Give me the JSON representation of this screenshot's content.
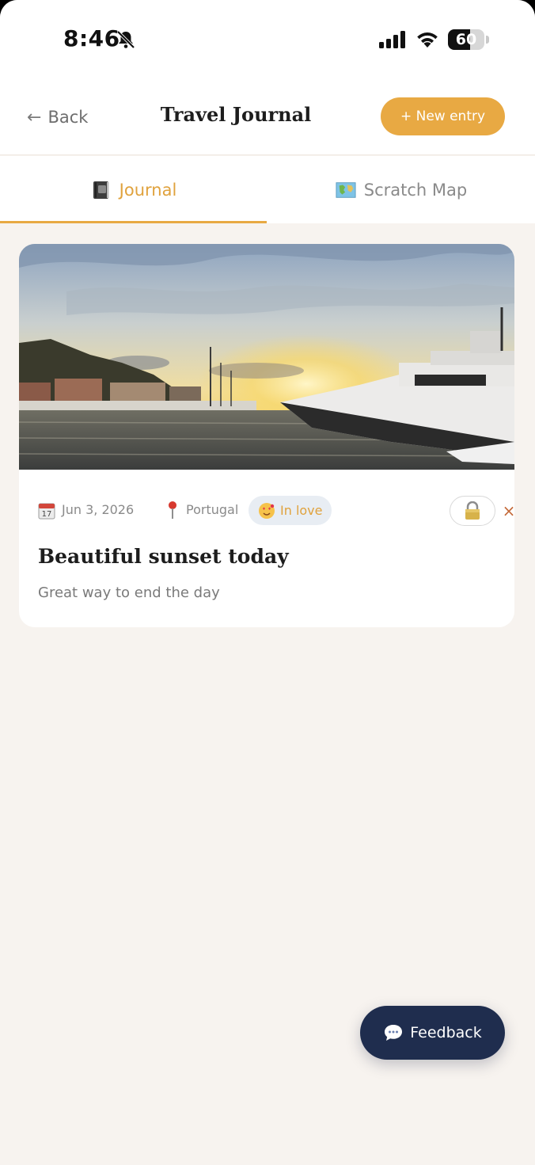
{
  "status_bar": {
    "time": "8:46",
    "battery_level": "60",
    "battery_percent": 60
  },
  "header": {
    "back_label": "Back",
    "back_arrow": "←",
    "title": "Travel Journal",
    "new_entry_label": "+ New entry"
  },
  "tabs": [
    {
      "label": "Journal",
      "icon": "book-icon",
      "active": true
    },
    {
      "label": "Scratch Map",
      "icon": "map-icon",
      "active": false
    }
  ],
  "entries": [
    {
      "image": "sunset-harbor-yacht-photo",
      "date": "Jun 3, 2026",
      "location": "Portugal",
      "mood": "In love",
      "mood_icon": "heart-eyes-face-icon",
      "private_icon": "lock-icon",
      "close_symbol": "×",
      "title": "Beautiful sunset today",
      "body": "Great way to end the day"
    }
  ],
  "feedback": {
    "label": "Feedback",
    "icon": "chat-bubble-icon"
  },
  "colors": {
    "accent": "#e8a943",
    "background": "#f7f3ef",
    "feedback_bg": "#1f2d4e",
    "mood_badge_bg": "#e8edf3"
  }
}
